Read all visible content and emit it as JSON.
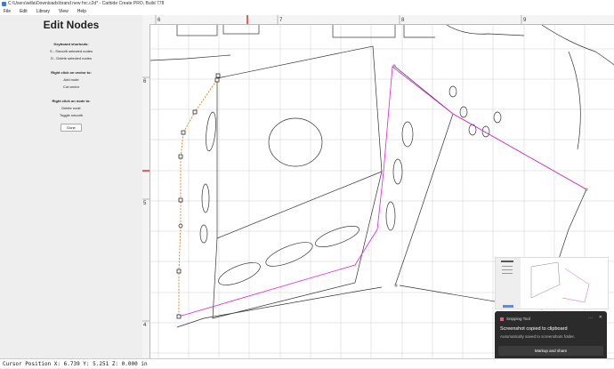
{
  "window": {
    "title": "C:\\Users\\willa\\Downloads\\brand new hrc.c2d* - Carbide Create PRO, Build 778"
  },
  "menu": [
    "File",
    "Edit",
    "Library",
    "View",
    "Help"
  ],
  "panel": {
    "title": "Edit Nodes",
    "keyboard_heading": "Keyboard shortcuts:",
    "keyboard_1": "S - Smooth selected nodes",
    "keyboard_2": "D - Delete selected nodes",
    "vector_heading": "Right click on vector to:",
    "vector_1": "Add node",
    "vector_2": "Cut vector",
    "node_heading": "Right click on node to:",
    "node_1": "Delete node",
    "node_2": "Toggle smooth",
    "done_label": "Done"
  },
  "ruler": {
    "top": [
      "6",
      "7",
      "8",
      "9"
    ],
    "left": [
      "6",
      "5",
      "4"
    ]
  },
  "status": {
    "text": "Cursor Position X: 6.739 Y: 5.251 Z: 0.000 in"
  },
  "toast": {
    "app": "Snipping Tool",
    "line1": "Screenshot copied to clipboard",
    "line2": "Automatically saved to screenshots folder.",
    "button": "Markup and share",
    "more": "···",
    "close": "✕"
  },
  "colors": {
    "node_path": "#e07820",
    "selected_vector": "#e020e0",
    "ruler_marker": "#d00000"
  }
}
